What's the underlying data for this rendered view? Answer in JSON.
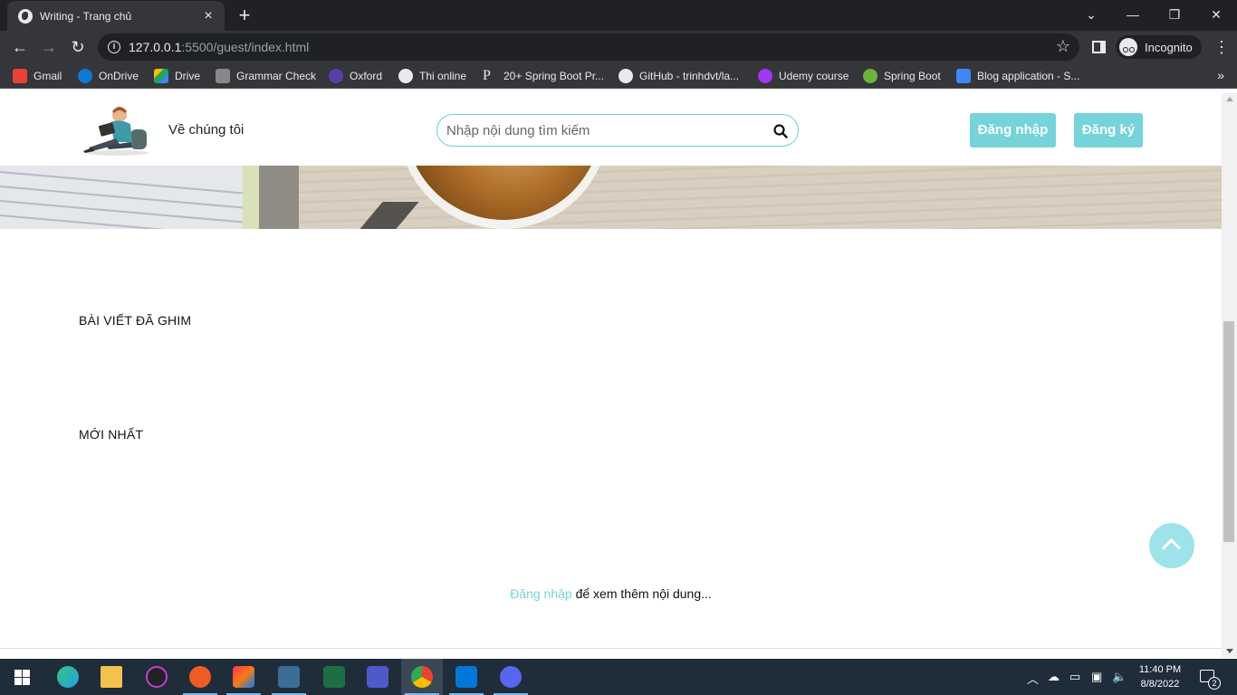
{
  "browser": {
    "tab_title": "Writing - Trang chủ",
    "url_host": "127.0.0.1",
    "url_rest": ":5500/guest/index.html",
    "incognito_label": "Incognito"
  },
  "bookmarks": [
    {
      "label": "Gmail",
      "icon": "gmail-icon",
      "color": "#ea4335"
    },
    {
      "label": "OnDrive",
      "icon": "onedrive-icon",
      "color": "#0f78d4"
    },
    {
      "label": "Drive",
      "icon": "google-drive-icon",
      "color": "#1fa463"
    },
    {
      "label": "Grammar Check",
      "icon": "grammar-icon",
      "color": "#888888"
    },
    {
      "label": "Oxford",
      "icon": "oxford-icon",
      "color": "#5b3fa6"
    },
    {
      "label": "Thi online",
      "icon": "thi-online-icon",
      "color": "#e8eaed"
    },
    {
      "label": "20+ Spring Boot Pr...",
      "icon": "p-icon",
      "color": "#202124"
    },
    {
      "label": "GitHub - trinhdvt/la...",
      "icon": "github-icon",
      "color": "#e8eaed"
    },
    {
      "label": "Udemy course",
      "icon": "udemy-icon",
      "color": "#a435f0"
    },
    {
      "label": "Spring Boot",
      "icon": "spring-icon",
      "color": "#6db33f"
    },
    {
      "label": "Blog application - S...",
      "icon": "blog-icon",
      "color": "#4285f4"
    }
  ],
  "site": {
    "about_label": "Về chúng tôi",
    "search_placeholder": "Nhập nội dung tìm kiếm",
    "login_label": "Đăng nhập",
    "signup_label": "Đăng ký",
    "accent_color": "#76d3da"
  },
  "sections": {
    "pinned_title": "BÀI VIẾT ĐÃ GHIM",
    "latest_title": "MỚI NHẤT"
  },
  "prompt": {
    "login_link": "Đăng nhập",
    "rest": " để xem thêm nội dung..."
  },
  "taskbar": {
    "apps": [
      {
        "name": "edge-icon",
        "color": "#1fa0e3"
      },
      {
        "name": "file-explorer-icon",
        "color": "#f2c14e"
      },
      {
        "name": "rgb-app-icon",
        "color": "#222222"
      },
      {
        "name": "postman-icon",
        "color": "#ef5b25"
      },
      {
        "name": "intellij-icon",
        "color": "#fe315d"
      },
      {
        "name": "mysql-workbench-icon",
        "color": "#3b6d96"
      },
      {
        "name": "excel-icon",
        "color": "#1d6f42"
      },
      {
        "name": "teams-icon",
        "color": "#5059c9"
      },
      {
        "name": "chrome-icon",
        "color": "#4285f4"
      },
      {
        "name": "vscode-icon",
        "color": "#0078d7"
      },
      {
        "name": "discord-icon",
        "color": "#5865f2"
      }
    ],
    "time": "11:40 PM",
    "date": "8/8/2022",
    "notification_count": "2"
  }
}
